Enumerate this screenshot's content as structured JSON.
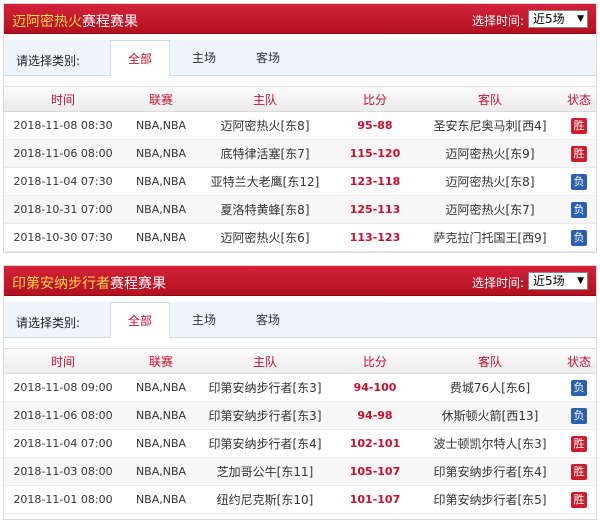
{
  "filter": {
    "label": "请选择类别:",
    "tabs": [
      "全部",
      "主场",
      "客场"
    ],
    "time_label": "选择时间:",
    "time_value": "近5场"
  },
  "columns": [
    "时间",
    "联赛",
    "主队",
    "比分",
    "客队",
    "状态"
  ],
  "panels": [
    {
      "team": "迈阿密热火",
      "suffix": "赛程赛果",
      "rows": [
        {
          "time": "2018-11-08 08:30",
          "league": "NBA,NBA",
          "home": "迈阿密热火[东8]",
          "score": "95-88",
          "away": "圣安东尼奥马刺[西4]",
          "result": "胜"
        },
        {
          "time": "2018-11-06 08:00",
          "league": "NBA,NBA",
          "home": "底特律活塞[东7]",
          "score": "115-120",
          "away": "迈阿密热火[东9]",
          "result": "胜"
        },
        {
          "time": "2018-11-04 07:30",
          "league": "NBA,NBA",
          "home": "亚特兰大老鹰[东12]",
          "score": "123-118",
          "away": "迈阿密热火[东8]",
          "result": "负"
        },
        {
          "time": "2018-10-31 07:00",
          "league": "NBA,NBA",
          "home": "夏洛特黄蜂[东8]",
          "score": "125-113",
          "away": "迈阿密热火[东7]",
          "result": "负"
        },
        {
          "time": "2018-10-30 07:30",
          "league": "NBA,NBA",
          "home": "迈阿密热火[东6]",
          "score": "113-123",
          "away": "萨克拉门托国王[西9]",
          "result": "负"
        }
      ]
    },
    {
      "team": "印第安纳步行者",
      "suffix": "赛程赛果",
      "rows": [
        {
          "time": "2018-11-08 09:00",
          "league": "NBA,NBA",
          "home": "印第安纳步行者[东3]",
          "score": "94-100",
          "away": "费城76人[东6]",
          "result": "负"
        },
        {
          "time": "2018-11-06 08:00",
          "league": "NBA,NBA",
          "home": "印第安纳步行者[东3]",
          "score": "94-98",
          "away": "休斯顿火箭[西13]",
          "result": "负"
        },
        {
          "time": "2018-11-04 07:00",
          "league": "NBA,NBA",
          "home": "印第安纳步行者[东4]",
          "score": "102-101",
          "away": "波士顿凯尔特人[东3]",
          "result": "胜"
        },
        {
          "time": "2018-11-03 08:00",
          "league": "NBA,NBA",
          "home": "芝加哥公牛[东11]",
          "score": "105-107",
          "away": "印第安纳步行者[东4]",
          "result": "胜"
        },
        {
          "time": "2018-11-01 08:00",
          "league": "NBA,NBA",
          "home": "纽约尼克斯[东10]",
          "score": "101-107",
          "away": "印第安纳步行者[东5]",
          "result": "胜"
        }
      ]
    }
  ]
}
